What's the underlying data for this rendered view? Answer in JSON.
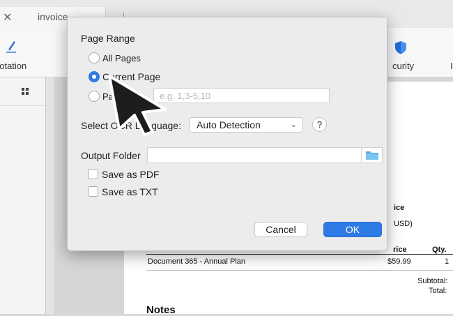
{
  "window": {
    "tab": {
      "close_glyph": "✕",
      "title": "invoice"
    },
    "toolbar": {
      "annotation_label": "notation",
      "security_label": "curity",
      "edge_label": "I"
    }
  },
  "document": {
    "header_invoice": "ice",
    "header_currency": "USD)",
    "col_price": "rice",
    "col_qty": "Qty.",
    "line_item": {
      "description": "Document 365 - Annual Plan",
      "price": "$59.99",
      "qty": "1"
    },
    "subtotal_label": "Subtotal:",
    "total_label": "Total:",
    "notes_heading": "Notes"
  },
  "dialog": {
    "page_range_title": "Page Range",
    "options": {
      "all_pages": "All Pages",
      "current_page": "Current Page",
      "pages": "Pages"
    },
    "selected_option": "current_page",
    "pages_placeholder": "e.g. 1,3-5,10",
    "ocr_language_label": "Select OCR Language:",
    "ocr_language_value": "Auto Detection",
    "help_glyph": "?",
    "output_folder_label": "Output Folder",
    "output_folder_value": "",
    "save_as_pdf": "Save as PDF",
    "save_as_pdf_checked": false,
    "save_as_txt": "Save as TXT",
    "save_as_txt_checked": false,
    "cancel_label": "Cancel",
    "ok_label": "OK"
  },
  "colors": {
    "accent": "#2f7be6",
    "security_icon": "#1f6fd8",
    "annotation_icon": "#3a6fd0",
    "folder_icon": "#5ab1e8"
  },
  "icons": [
    "close-icon",
    "pen-icon",
    "shield-icon",
    "grid-icon",
    "chevron-down-icon",
    "folder-icon",
    "mouse-pointer-icon"
  ]
}
